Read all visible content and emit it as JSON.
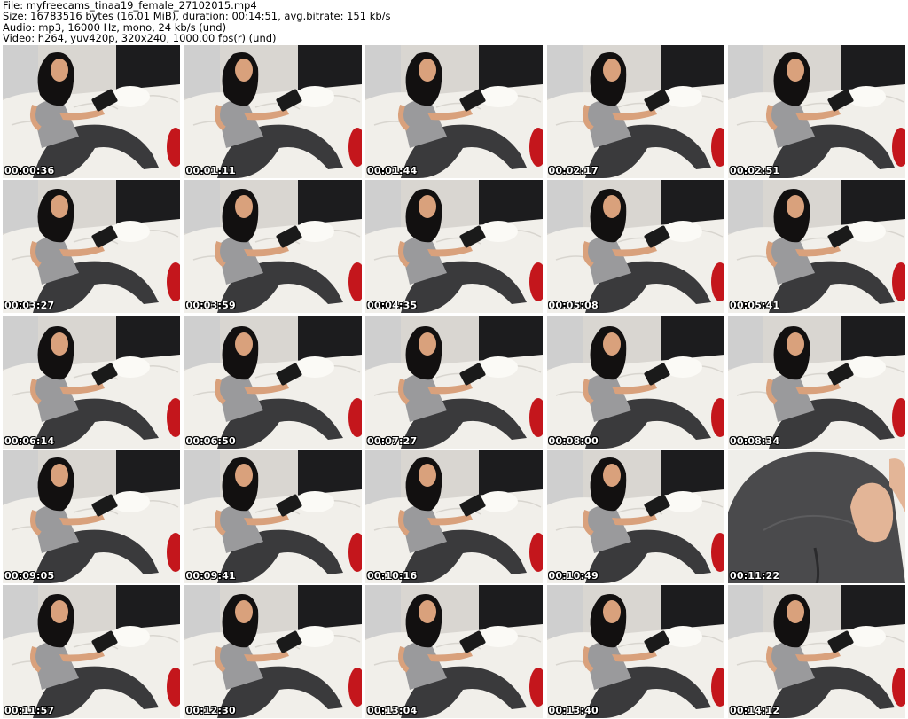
{
  "header": {
    "file_line": "File: myfreecams_tinaa19_female_27102015.mp4",
    "size_line": "Size: 16783516 bytes (16.01 MiB), duration: 00:14:51, avg.bitrate: 151 kb/s",
    "audio_line": "Audio: mp3, 16000 Hz, mono, 24 kb/s (und)",
    "video_line": "Video: h264, yuv420p, 320x240, 1000.00 fps(r) (und)"
  },
  "thumbnails": [
    {
      "timestamp": "00:00:36"
    },
    {
      "timestamp": "00:01:11"
    },
    {
      "timestamp": "00:01:44"
    },
    {
      "timestamp": "00:02:17"
    },
    {
      "timestamp": "00:02:51"
    },
    {
      "timestamp": "00:03:27"
    },
    {
      "timestamp": "00:03:59"
    },
    {
      "timestamp": "00:04:35"
    },
    {
      "timestamp": "00:05:08"
    },
    {
      "timestamp": "00:05:41"
    },
    {
      "timestamp": "00:06:14"
    },
    {
      "timestamp": "00:06:50"
    },
    {
      "timestamp": "00:07:27"
    },
    {
      "timestamp": "00:08:00"
    },
    {
      "timestamp": "00:08:34"
    },
    {
      "timestamp": "00:09:05"
    },
    {
      "timestamp": "00:09:41"
    },
    {
      "timestamp": "00:10:16"
    },
    {
      "timestamp": "00:10:49"
    },
    {
      "timestamp": "00:11:22",
      "closeup": true
    },
    {
      "timestamp": "00:11:57"
    },
    {
      "timestamp": "00:12:30"
    },
    {
      "timestamp": "00:13:04"
    },
    {
      "timestamp": "00:13:40"
    },
    {
      "timestamp": "00:14:12"
    }
  ],
  "colors": {
    "wall": "#d9d6d1",
    "curtain": "#1c1c1e",
    "sofa": "#f1efea",
    "pillow_red": "#c4161c",
    "leggings": "#3a3a3c",
    "top": "#9a9a9c",
    "skin": "#d9a17c",
    "hair": "#121010"
  }
}
